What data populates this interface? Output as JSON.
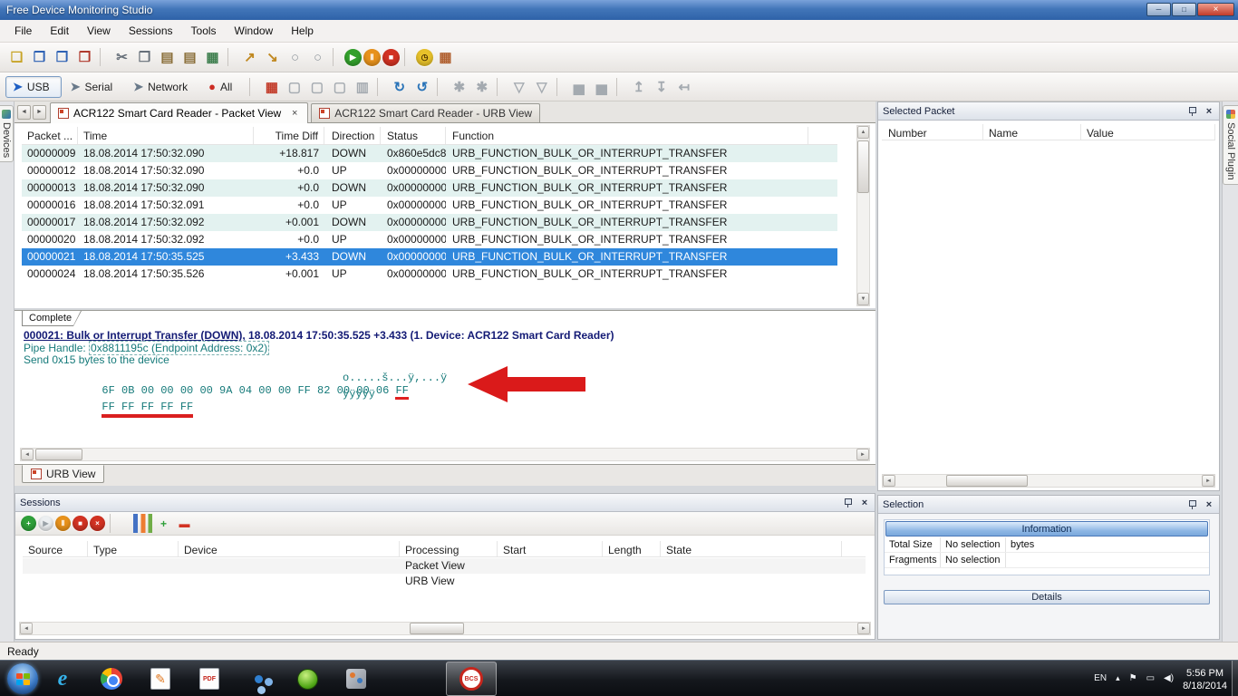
{
  "titlebar": {
    "title": "Free Device Monitoring Studio"
  },
  "window_controls": {
    "minimize": "─",
    "maximize": "□",
    "close": "×"
  },
  "menu": {
    "items": [
      "File",
      "Edit",
      "View",
      "Sessions",
      "Tools",
      "Window",
      "Help"
    ]
  },
  "toolbar_main": {
    "icons": [
      {
        "name": "new-document-icon",
        "glyph": "❏",
        "fg": "#c8a428"
      },
      {
        "name": "save-icon",
        "glyph": "❒",
        "fg": "#2f62b4"
      },
      {
        "name": "save-all-icon",
        "glyph": "❒",
        "fg": "#2f62b4"
      },
      {
        "name": "close-save-icon",
        "glyph": "❒",
        "fg": "#b03a2e"
      },
      {
        "kind": "sep"
      },
      {
        "name": "cut-icon",
        "glyph": "✂",
        "fg": "#67707a"
      },
      {
        "name": "copy-icon",
        "glyph": "❐",
        "fg": "#67707a"
      },
      {
        "name": "paste-icon",
        "glyph": "▤",
        "fg": "#8a6f3a"
      },
      {
        "name": "paste-append-icon",
        "glyph": "▤",
        "fg": "#8a6f3a"
      },
      {
        "name": "export-grid-icon",
        "glyph": "▦",
        "fg": "#3f7f4f"
      },
      {
        "kind": "sep"
      },
      {
        "name": "send-to-icon",
        "glyph": "↗",
        "fg": "#c08820"
      },
      {
        "name": "forward-to-icon",
        "glyph": "↘",
        "fg": "#c08820"
      },
      {
        "name": "ring-icon",
        "glyph": "○",
        "fg": "#8f969c"
      },
      {
        "name": "ring-alt-icon",
        "glyph": "○",
        "fg": "#8f969c"
      },
      {
        "kind": "sep"
      },
      {
        "name": "start-monitoring-icon",
        "kind": "circle",
        "bg": "#33a02c",
        "glyph": "▶"
      },
      {
        "name": "pause-monitoring-icon",
        "kind": "circle",
        "bg": "#e8921c",
        "glyph": "Ⅱ"
      },
      {
        "name": "stop-monitoring-icon",
        "kind": "circle",
        "bg": "#d23222",
        "glyph": "■"
      },
      {
        "kind": "sep"
      },
      {
        "name": "clock-icon",
        "kind": "circle",
        "bg": "#e8c22a",
        "glyph": "◷",
        "fg": "#4a3000"
      },
      {
        "name": "export-session-icon",
        "glyph": "▦",
        "fg": "#b06030"
      }
    ]
  },
  "toolbar_device": {
    "buttons": [
      {
        "label": "USB",
        "glyph": "➤",
        "icon_style": "color:#1f5fc4"
      },
      {
        "label": "Serial",
        "glyph": "➤",
        "icon_style": "color:#6a7a8a"
      },
      {
        "label": "Network",
        "glyph": "➤",
        "icon_style": "color:#6a7a8a"
      },
      {
        "label": "All",
        "glyph": "●",
        "icon_style": "color:#cc2b22"
      }
    ],
    "icons": [
      {
        "kind": "sep"
      },
      {
        "name": "capture-grid-icon",
        "glyph": "▦",
        "fg": "#c23a28"
      },
      {
        "name": "select-window-icon",
        "glyph": "▢",
        "fg": "#a4aab0"
      },
      {
        "name": "select-window-alt-icon",
        "glyph": "▢",
        "fg": "#a4aab0"
      },
      {
        "name": "select-process-icon",
        "glyph": "▢",
        "fg": "#a4aab0"
      },
      {
        "name": "page-setup-icon",
        "glyph": "▥",
        "fg": "#a4aab0"
      },
      {
        "kind": "sep"
      },
      {
        "name": "rotate-cw-icon",
        "glyph": "↻",
        "fg": "#2a74b8"
      },
      {
        "name": "rotate-ccw-icon",
        "glyph": "↺",
        "fg": "#2a74b8"
      },
      {
        "kind": "sep"
      },
      {
        "name": "process-link-icon",
        "glyph": "✱",
        "fg": "#a4aab0"
      },
      {
        "name": "process-link-alt-icon",
        "glyph": "✱",
        "fg": "#a4aab0"
      },
      {
        "kind": "sep"
      },
      {
        "name": "filter-icon",
        "glyph": "▽",
        "fg": "#a4aab0"
      },
      {
        "name": "filter-clear-icon",
        "glyph": "▽",
        "fg": "#a4aab0"
      },
      {
        "kind": "sep"
      },
      {
        "name": "chart-icon",
        "glyph": "▅",
        "fg": "#a4aab0"
      },
      {
        "name": "chart-alt-icon",
        "glyph": "▅",
        "fg": "#a4aab0"
      },
      {
        "kind": "sep"
      },
      {
        "name": "import-data-icon",
        "glyph": "↥",
        "fg": "#a4aab0"
      },
      {
        "name": "export-data-icon",
        "glyph": "↧",
        "fg": "#a4aab0"
      },
      {
        "name": "save-data-icon",
        "glyph": "↤",
        "fg": "#a4aab0"
      }
    ]
  },
  "left_strip": {
    "label": "Devices"
  },
  "right_strip": {
    "label": "Social Plugin"
  },
  "doc_tabs": {
    "tabs": [
      {
        "label": "ACR122 Smart Card Reader - Packet View"
      },
      {
        "label": "ACR122 Smart Card Reader - URB View"
      }
    ]
  },
  "packet_table": {
    "columns": [
      "Packet ...",
      "Time",
      "Time Diff",
      "Direction",
      "Status",
      "Function"
    ],
    "selected_index": 6,
    "rows": [
      [
        "00000009",
        "18.08.2014 17:50:32.090",
        "+18.817",
        "DOWN",
        "0x860e5dc8",
        "URB_FUNCTION_BULK_OR_INTERRUPT_TRANSFER"
      ],
      [
        "00000012",
        "18.08.2014 17:50:32.090",
        "+0.0",
        "UP",
        "0x00000000",
        "URB_FUNCTION_BULK_OR_INTERRUPT_TRANSFER"
      ],
      [
        "00000013",
        "18.08.2014 17:50:32.090",
        "+0.0",
        "DOWN",
        "0x00000000",
        "URB_FUNCTION_BULK_OR_INTERRUPT_TRANSFER"
      ],
      [
        "00000016",
        "18.08.2014 17:50:32.091",
        "+0.0",
        "UP",
        "0x00000000",
        "URB_FUNCTION_BULK_OR_INTERRUPT_TRANSFER"
      ],
      [
        "00000017",
        "18.08.2014 17:50:32.092",
        "+0.001",
        "DOWN",
        "0x00000000",
        "URB_FUNCTION_BULK_OR_INTERRUPT_TRANSFER"
      ],
      [
        "00000020",
        "18.08.2014 17:50:32.092",
        "+0.0",
        "UP",
        "0x00000000",
        "URB_FUNCTION_BULK_OR_INTERRUPT_TRANSFER"
      ],
      [
        "00000021",
        "18.08.2014 17:50:35.525",
        "+3.433",
        "DOWN",
        "0x00000000",
        "URB_FUNCTION_BULK_OR_INTERRUPT_TRANSFER"
      ],
      [
        "00000024",
        "18.08.2014 17:50:35.526",
        "+0.001",
        "UP",
        "0x00000000",
        "URB_FUNCTION_BULK_OR_INTERRUPT_TRANSFER"
      ]
    ]
  },
  "detail_pane": {
    "tab_label": "Complete",
    "title_link": "000021: Bulk or Interrupt Transfer (DOWN),",
    "title_rest": " 18.08.2014 17:50:35.525 +3.433 (1. Device: ACR122 Smart Card Reader)",
    "pipe_label": "Pipe Handle: ",
    "pipe_value": "0x8811195c (Endpoint Address: 0x2)",
    "send_line": "Send 0x15 bytes to the device",
    "hex_line1_main": "6F 0B 00 00 00 00 9A 04 00 00 FF 82 00 00 06 ",
    "hex_line1_marked": "FF",
    "ascii_line1": "o.....š...ÿ,...ÿ",
    "hex_line2_marked": "FF FF FF FF FF",
    "ascii_line2": "ÿÿÿÿÿ",
    "bottom_tab_label": "URB View"
  },
  "sessions_panel": {
    "title": "Sessions",
    "toolbar_icons": [
      {
        "name": "new-session-icon",
        "kind": "circle",
        "bg": "#2fa03a",
        "glyph": "+"
      },
      {
        "name": "start-session-icon",
        "kind": "circle",
        "bg": "#eceff1",
        "glyph": "▶",
        "fg": "#9aa2a8"
      },
      {
        "name": "pause-session-icon",
        "kind": "circle",
        "bg": "#e8921c",
        "glyph": "Ⅱ"
      },
      {
        "name": "stop-session-icon",
        "kind": "circle",
        "bg": "#d23222",
        "glyph": "■"
      },
      {
        "name": "delete-session-icon",
        "kind": "circle",
        "bg": "#d23222",
        "glyph": "×"
      },
      {
        "kind": "sep"
      },
      {
        "name": "statistics-icon",
        "kind": "bars"
      },
      {
        "name": "add-processing-icon",
        "glyph": "+",
        "fg": "#2fa03a"
      },
      {
        "name": "remove-processing-icon",
        "glyph": "▬",
        "fg": "#d23222"
      }
    ],
    "columns": [
      "Source",
      "Type",
      "Device",
      "Processing",
      "Start",
      "Length",
      "State"
    ],
    "rows": [
      [
        "",
        "",
        "",
        "Packet View",
        "",
        "",
        ""
      ],
      [
        "",
        "",
        "",
        "URB View",
        "",
        "",
        ""
      ]
    ]
  },
  "selected_packet_panel": {
    "title": "Selected Packet",
    "columns": [
      "Number",
      "Name",
      "Value"
    ]
  },
  "selection_panel": {
    "title": "Selection",
    "information_header": "Information",
    "fields": [
      {
        "label": "Total Size",
        "value": "No selection",
        "unit": "bytes"
      },
      {
        "label": "Fragments",
        "value": "No selection",
        "unit": ""
      }
    ],
    "details_header": "Details"
  },
  "statusbar": {
    "text": "Ready"
  },
  "taskbar": {
    "bcs_label": "BCS",
    "pdf_label": "PDF",
    "ie_letter": "e",
    "pen_glyph": "✎",
    "tray": {
      "language": "EN",
      "hidden_icons": "▴",
      "flag": "⚑",
      "monitor": "▭",
      "volume": "◀)",
      "time": "5:56 PM",
      "date": "8/18/2014"
    }
  },
  "icons_glyphs": {
    "close": "×",
    "scroll_up": "▲",
    "scroll_down": "▼",
    "scroll_left": "◄",
    "scroll_right": "►"
  },
  "colors": {
    "accent_selected_row": "#2f87dc",
    "annotation_red": "#da1a1a",
    "hex_text": "#167a7a"
  }
}
